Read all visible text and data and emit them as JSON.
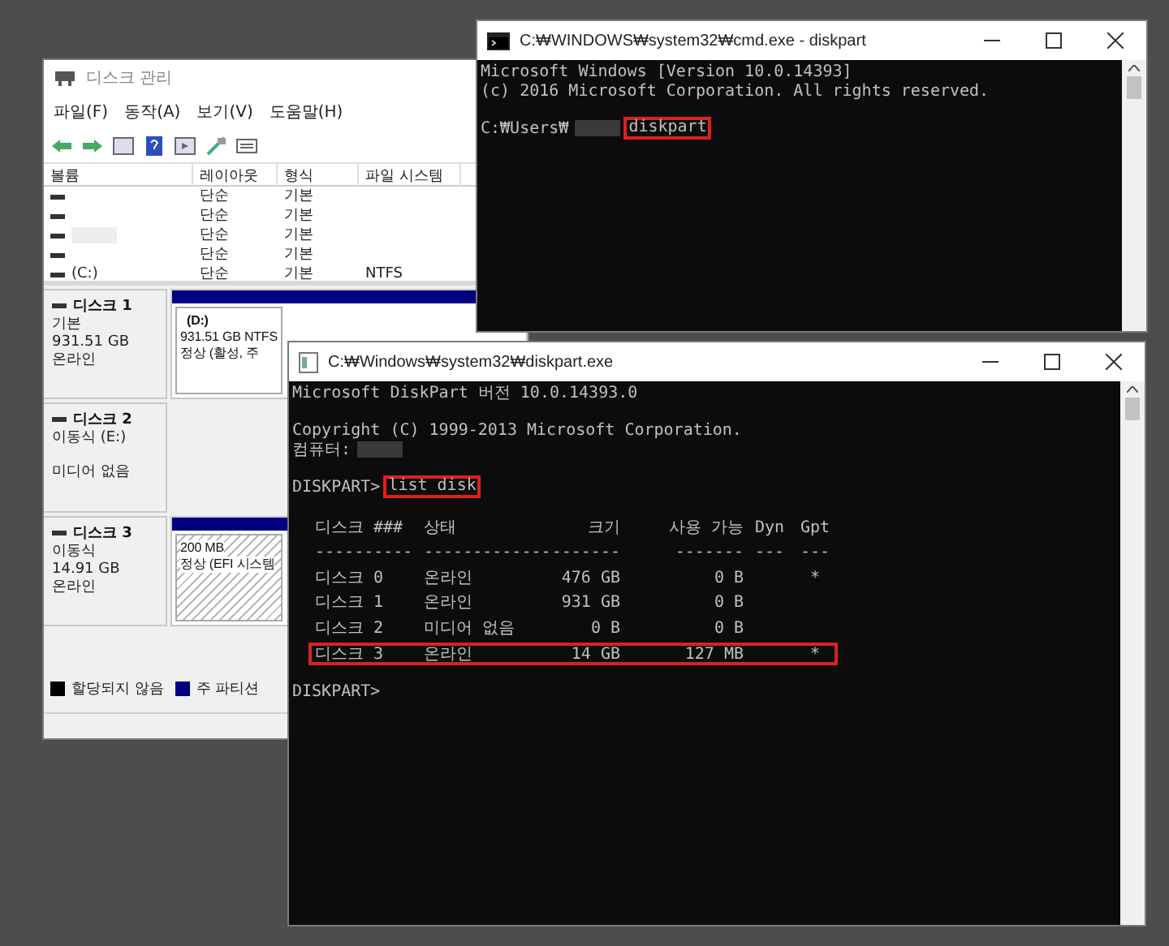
{
  "disk_management": {
    "title": "디스크 관리",
    "menu": [
      "파일(F)",
      "동작(A)",
      "보기(V)",
      "도움말(H)"
    ],
    "volume_table": {
      "columns": [
        "볼륨",
        "레이아웃",
        "형식",
        "파일 시스템"
      ],
      "rows": [
        {
          "redacted": false,
          "layout": "단순",
          "type": "기본"
        },
        {
          "redacted": false,
          "layout": "단순",
          "type": "기본"
        },
        {
          "redacted": true,
          "layout": "단순",
          "type": "기본"
        },
        {
          "redacted": false,
          "layout": "단순",
          "type": "기본"
        },
        {
          "redacted": false,
          "volume": "(C:)",
          "layout": "단순",
          "type": "기본",
          "file_system": "NTFS"
        }
      ]
    },
    "disks": [
      {
        "name": "디스크 1",
        "info": [
          "기본",
          "931.51 GB",
          "온라인"
        ],
        "partition": {
          "selected": false,
          "label": "(D:)",
          "lines": [
            "931.51 GB NTFS",
            "정상 (활성, 주"
          ]
        }
      },
      {
        "name": "디스크 2",
        "info": [
          "이동식 (E:)"
        ],
        "note": "미디어 없음"
      },
      {
        "name": "디스크 3",
        "info": [
          "이동식",
          "14.91 GB",
          "온라인"
        ],
        "partition": {
          "selected": true,
          "lines": [
            "200 MB",
            "정상 (EFI 시스템"
          ]
        }
      }
    ],
    "legend": [
      {
        "label": "할당되지 않음",
        "color": "#000000"
      },
      {
        "label": "주 파티션",
        "color": "#000080"
      }
    ]
  },
  "cmd_window": {
    "title": "C:₩WINDOWS₩system32₩cmd.exe - diskpart",
    "lines": [
      {
        "kind": "text",
        "text": "Microsoft Windows [Version 10.0.14393]"
      },
      {
        "kind": "text",
        "text": "(c) 2016 Microsoft Corporation. All rights reserved."
      },
      {
        "kind": "blank"
      },
      {
        "kind": "prompt",
        "prefix": "C:₩Users₩",
        "redacted": true,
        "command": "diskpart",
        "highlighted": true
      }
    ]
  },
  "diskpart_window": {
    "title": "C:₩Windows₩system32₩diskpart.exe",
    "lines": [
      {
        "kind": "text",
        "text": "Microsoft DiskPart 버전 10.0.14393.0"
      },
      {
        "kind": "blank"
      },
      {
        "kind": "text",
        "text": "Copyright (C) 1999-2013 Microsoft Corporation."
      },
      {
        "kind": "prompt",
        "prefix": "컴퓨터:",
        "redacted": true
      },
      {
        "kind": "blank"
      },
      {
        "kind": "prompt",
        "prefix": "DISKPART>",
        "redacted": false,
        "command": "list disk",
        "highlighted": true
      },
      {
        "kind": "blank"
      },
      {
        "kind": "table"
      },
      {
        "kind": "blank"
      },
      {
        "kind": "text",
        "text": "DISKPART>"
      }
    ],
    "list_disk": {
      "columns": [
        {
          "label": "디스크 ###",
          "rule": "----------"
        },
        {
          "label": "상태",
          "rule": "-------------"
        },
        {
          "label": "크기",
          "rule": "-------"
        },
        {
          "label": "사용 가능",
          "rule": "-------"
        },
        {
          "label": "Dyn",
          "rule": "---"
        },
        {
          "label": "Gpt",
          "rule": "---"
        }
      ],
      "rows": [
        {
          "highlighted": false,
          "cells": [
            "디스크 0",
            "온라인",
            "476 GB",
            "0 B",
            null,
            "*"
          ]
        },
        {
          "highlighted": false,
          "cells": [
            "디스크 1",
            "온라인",
            "931 GB",
            "0 B",
            null,
            null
          ]
        },
        {
          "highlighted": false,
          "cells": [
            "디스크 2",
            "미디어 없음",
            "0 B",
            "0 B",
            null,
            null
          ]
        },
        {
          "highlighted": true,
          "cells": [
            "디스크 3",
            "온라인",
            "14 GB",
            "127 MB",
            null,
            "*"
          ]
        }
      ]
    }
  }
}
